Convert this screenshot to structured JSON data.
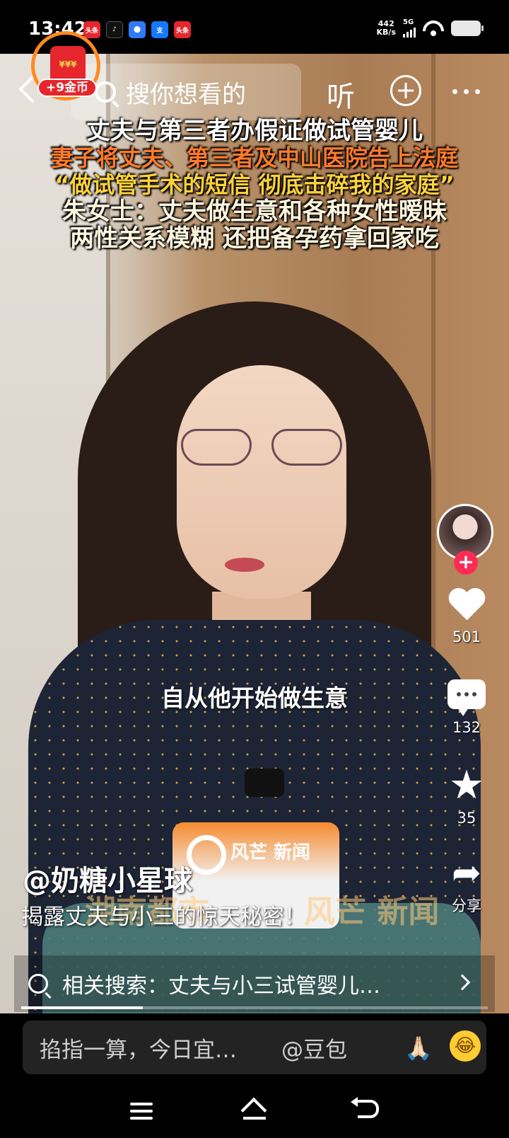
{
  "status_bar": {
    "time": "13:42",
    "app_icons": [
      {
        "name": "toutiao-icon",
        "label": "头条",
        "color": "#e5262d"
      },
      {
        "name": "tiktok-icon",
        "label": "♪",
        "color": "#111111"
      },
      {
        "name": "app-blue-icon",
        "label": "⬤",
        "color": "#2f7bf5"
      },
      {
        "name": "alipay-icon",
        "label": "支",
        "color": "#1677ff"
      },
      {
        "name": "toutiao-icon-2",
        "label": "头条",
        "color": "#e5262d"
      }
    ],
    "net_speed": "442",
    "net_unit": "KB/s",
    "network": "5G"
  },
  "coin_widget": {
    "envelope_text": "¥¥¥",
    "label": "+9金币"
  },
  "top_nav": {
    "search_placeholder": "搜你想看的",
    "listen_label": "听"
  },
  "headline": {
    "line1": "丈夫与第三者办假证做试管婴儿",
    "line2": "妻子将丈夫、第三者及中山医院告上法庭",
    "line3": "“做试管手术的短信 彻底击碎我的家庭”",
    "line4": "朱女士：丈夫做生意和各种女性暧昧",
    "line5": "两性关系模糊 还把备孕药拿回家吃"
  },
  "video": {
    "subtitle": "自从他开始做生意",
    "mic_brand": "风芒 新闻",
    "watermark_left": "湖南都市",
    "watermark_right": "风芒 新闻"
  },
  "actions": {
    "likes": "501",
    "comments": "132",
    "favorites": "35",
    "share_label": "分享",
    "follow_symbol": "+"
  },
  "post": {
    "author": "@奶糖小星球",
    "description": "揭露丈夫与小三的惊天秘密！"
  },
  "related_search": {
    "text": "相关搜索：丈夫与小三试管婴儿…"
  },
  "playback": {
    "progress_fraction": 0.26
  },
  "ai_prompt": {
    "text": "掐指一算，今日宜…",
    "mention": "@豆包",
    "emoji1": "🙏🏻",
    "emoji2": "😂"
  }
}
